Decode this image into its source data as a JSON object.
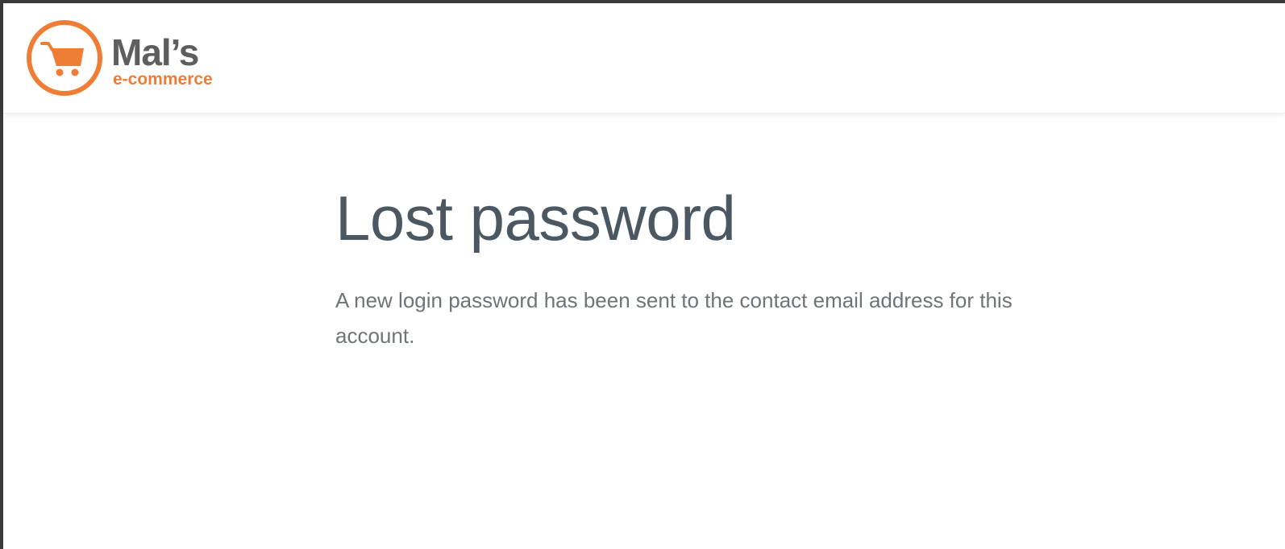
{
  "header": {
    "logo": {
      "name": "Mal’s",
      "tagline": "e-commerce",
      "icon": "shopping-cart-icon",
      "brand_color": "#ee7d35",
      "text_color": "#5e5e5e"
    }
  },
  "main": {
    "title": "Lost password",
    "message": "A new login password has been sent to the contact email address for this account."
  },
  "colors": {
    "title": "#4b5761",
    "message": "#6f7477",
    "background": "#ffffff"
  }
}
